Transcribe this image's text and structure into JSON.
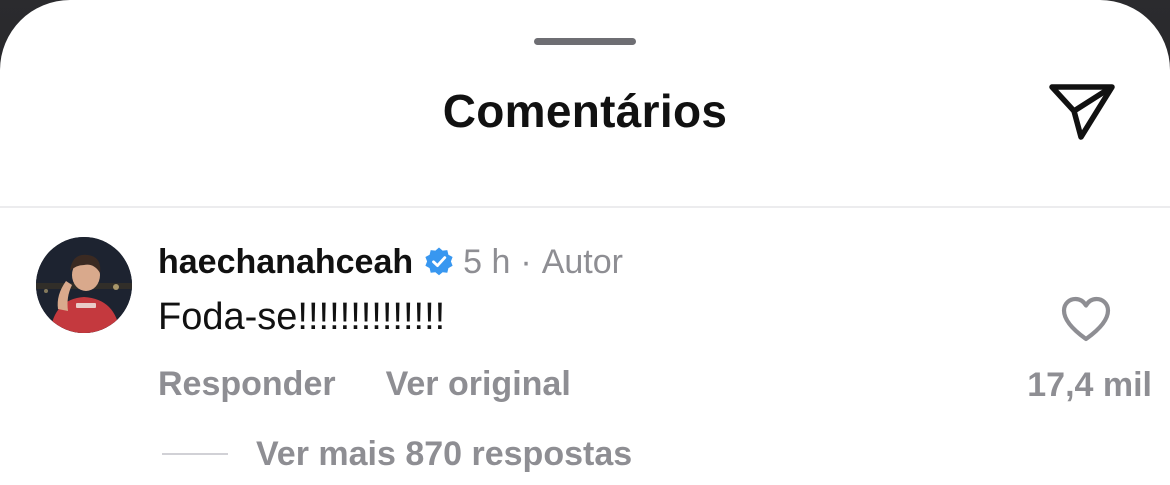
{
  "sheet": {
    "title": "Comentários"
  },
  "icons": {
    "share": "paper-plane-icon",
    "verified": "verified-badge-icon",
    "like": "heart-outline-icon"
  },
  "colors": {
    "primary_text": "#111111",
    "secondary_text": "#8e8e93",
    "verified_badge": "#3897f0",
    "background": "#ffffff"
  },
  "comment": {
    "username": "haechanahceah",
    "time": "5 h",
    "separator": "·",
    "author_tag": "Autor",
    "text": "Foda-se!!!!!!!!!!!!!!",
    "actions": {
      "reply": "Responder",
      "see_original": "Ver original"
    },
    "like_count": "17,4 mil",
    "more_replies": "Ver mais 870 respostas"
  }
}
